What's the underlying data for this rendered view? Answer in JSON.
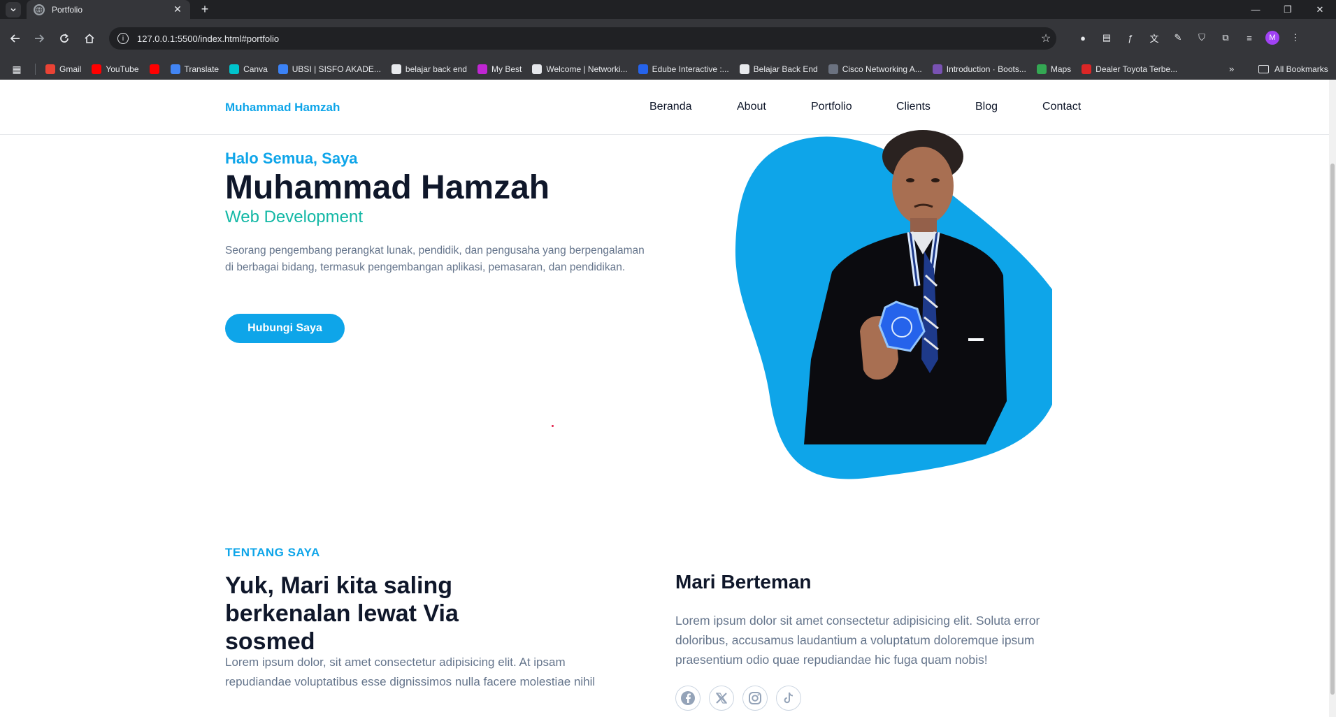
{
  "browser": {
    "tab_title": "Portfolio",
    "url": "127.0.0.1:5500/index.html#portfolio",
    "bookmarks": [
      {
        "label": "Gmail",
        "color": "#ea4335"
      },
      {
        "label": "YouTube",
        "color": "#ff0000"
      },
      {
        "label": "",
        "color": "#ff0000"
      },
      {
        "label": "Translate",
        "color": "#4285f4"
      },
      {
        "label": "Canva",
        "color": "#00c4cc"
      },
      {
        "label": "UBSI | SISFO AKADE...",
        "color": "#3b82f6"
      },
      {
        "label": "belajar back end",
        "color": "#e8eaed"
      },
      {
        "label": "My Best",
        "color": "#c026d3"
      },
      {
        "label": "Welcome | Networki...",
        "color": "#e5e7eb"
      },
      {
        "label": "Edube Interactive :...",
        "color": "#2563eb"
      },
      {
        "label": "Belajar Back End",
        "color": "#e8eaed"
      },
      {
        "label": "Cisco Networking A...",
        "color": "#6b7280"
      },
      {
        "label": "Introduction · Boots...",
        "color": "#7952b3"
      },
      {
        "label": "Maps",
        "color": "#34a853"
      },
      {
        "label": "Dealer Toyota Terbe...",
        "color": "#dc2626"
      }
    ],
    "all_bookmarks": "All Bookmarks",
    "profile_initial": "M"
  },
  "site": {
    "logo": "Muhammad Hamzah",
    "nav": [
      "Beranda",
      "About",
      "Portfolio",
      "Clients",
      "Blog",
      "Contact"
    ]
  },
  "hero": {
    "greeting": "Halo Semua, Saya",
    "name": "Muhammad Hamzah",
    "role": "Web Development",
    "description": "Seorang pengembang perangkat lunak, pendidik, dan pengusaha yang berpengalaman di berbagai bidang, termasuk pengembangan aplikasi, pemasaran, dan pendidikan.",
    "cta": "Hubungi Saya",
    "blob_color": "#0ea5e9"
  },
  "about": {
    "label": "TENTANG SAYA",
    "title": "Yuk, Mari kita saling berkenalan lewat Via sosmed",
    "text": "Lorem ipsum dolor, sit amet consectetur adipisicing elit. At ipsam repudiandae voluptatibus esse dignissimos nulla facere molestiae nihil"
  },
  "friends": {
    "title": "Mari Berteman",
    "text": "Lorem ipsum dolor sit amet consectetur adipisicing elit. Soluta error doloribus, accusamus laudantium a voluptatum doloremque ipsum praesentium odio quae repudiandae hic fuga quam nobis!",
    "socials": [
      "facebook-icon",
      "x-icon",
      "instagram-icon",
      "tiktok-icon"
    ]
  },
  "colors": {
    "accent": "#0ea5e9",
    "teal": "#14b8a6",
    "heading": "#0f172a",
    "muted": "#64748b"
  }
}
